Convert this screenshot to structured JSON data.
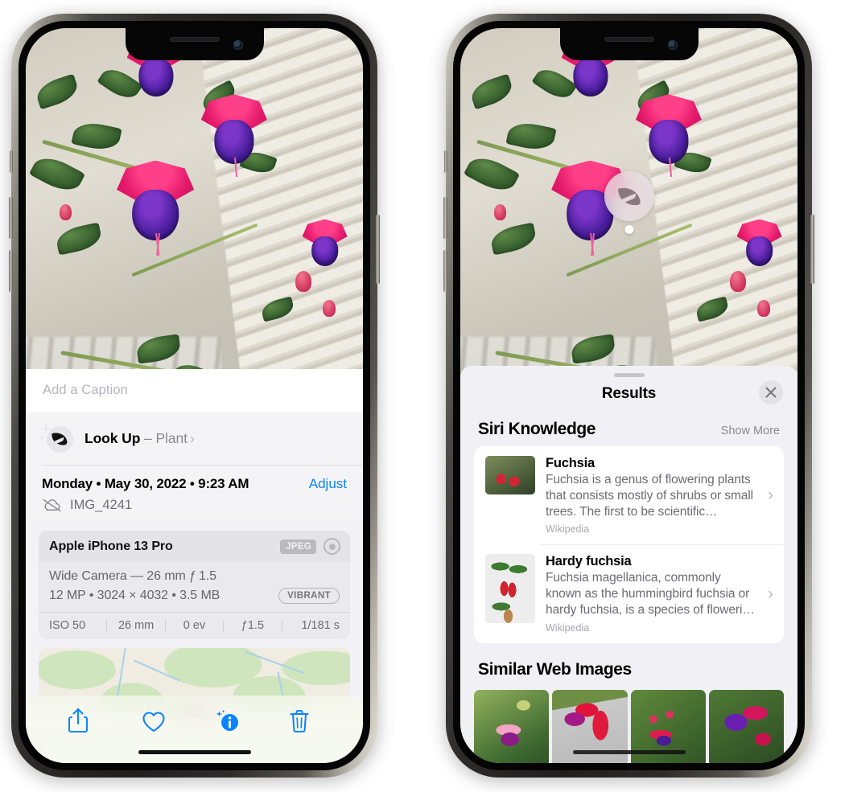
{
  "left_phone": {
    "photo": {
      "alt": "fuchsia-flowers-hanging-basket"
    },
    "caption_placeholder": "Add a Caption",
    "lookup": {
      "label": "Look Up",
      "dash": " – ",
      "subject": "Plant",
      "chevron": "›",
      "icon": "leaf-sparkle-icon"
    },
    "metadata": {
      "date": "Monday • May 30, 2022 • 9:23 AM",
      "adjust_label": "Adjust",
      "cloud_icon": "cloud-slash-icon",
      "filename": "IMG_4241"
    },
    "camera_card": {
      "device": "Apple iPhone 13 Pro",
      "format_badge": "JPEG",
      "raw_icon": "aperture-icon",
      "lens_line": "Wide Camera — 26 mm ƒ 1.5",
      "specs_line": "12 MP • 3024 × 4032 • 3.5 MB",
      "style_badge": "VIBRANT",
      "exif": [
        "ISO 50",
        "26 mm",
        "0 ev",
        "ƒ1.5",
        "1/181 s"
      ]
    },
    "map": {
      "alt": "photo-location-map"
    },
    "toolbar": [
      {
        "name": "share-icon",
        "label": "Share"
      },
      {
        "name": "heart-icon",
        "label": "Favorite"
      },
      {
        "name": "info-sparkle-icon",
        "label": "Info"
      },
      {
        "name": "trash-icon",
        "label": "Delete"
      }
    ],
    "accent_color": "#0a84ff"
  },
  "right_phone": {
    "badge": {
      "icon": "leaf-icon",
      "name": "visual-look-up-badge"
    },
    "sheet": {
      "title": "Results",
      "close_icon": "close-icon",
      "sections": [
        {
          "title": "Siri Knowledge",
          "action": "Show More",
          "cards": [
            {
              "title": "Fuchsia",
              "description": "Fuchsia is a genus of flowering plants that consists mostly of shrubs or small trees. The first to be scientific…",
              "source": "Wikipedia",
              "thumb": "fuchsia-red-flowers-thumb",
              "chevron": "›"
            },
            {
              "title": "Hardy fuchsia",
              "description": "Fuchsia magellanica, commonly known as the hummingbird fuchsia or hardy fuchsia, is a species of floweri…",
              "source": "Wikipedia",
              "thumb": "hardy-fuchsia-branch-thumb",
              "chevron": "›"
            }
          ]
        },
        {
          "title": "Similar Web Images",
          "tiles": [
            {
              "name": "similar-image-1"
            },
            {
              "name": "similar-image-2"
            },
            {
              "name": "similar-image-3"
            },
            {
              "name": "similar-image-4"
            }
          ]
        }
      ]
    }
  }
}
